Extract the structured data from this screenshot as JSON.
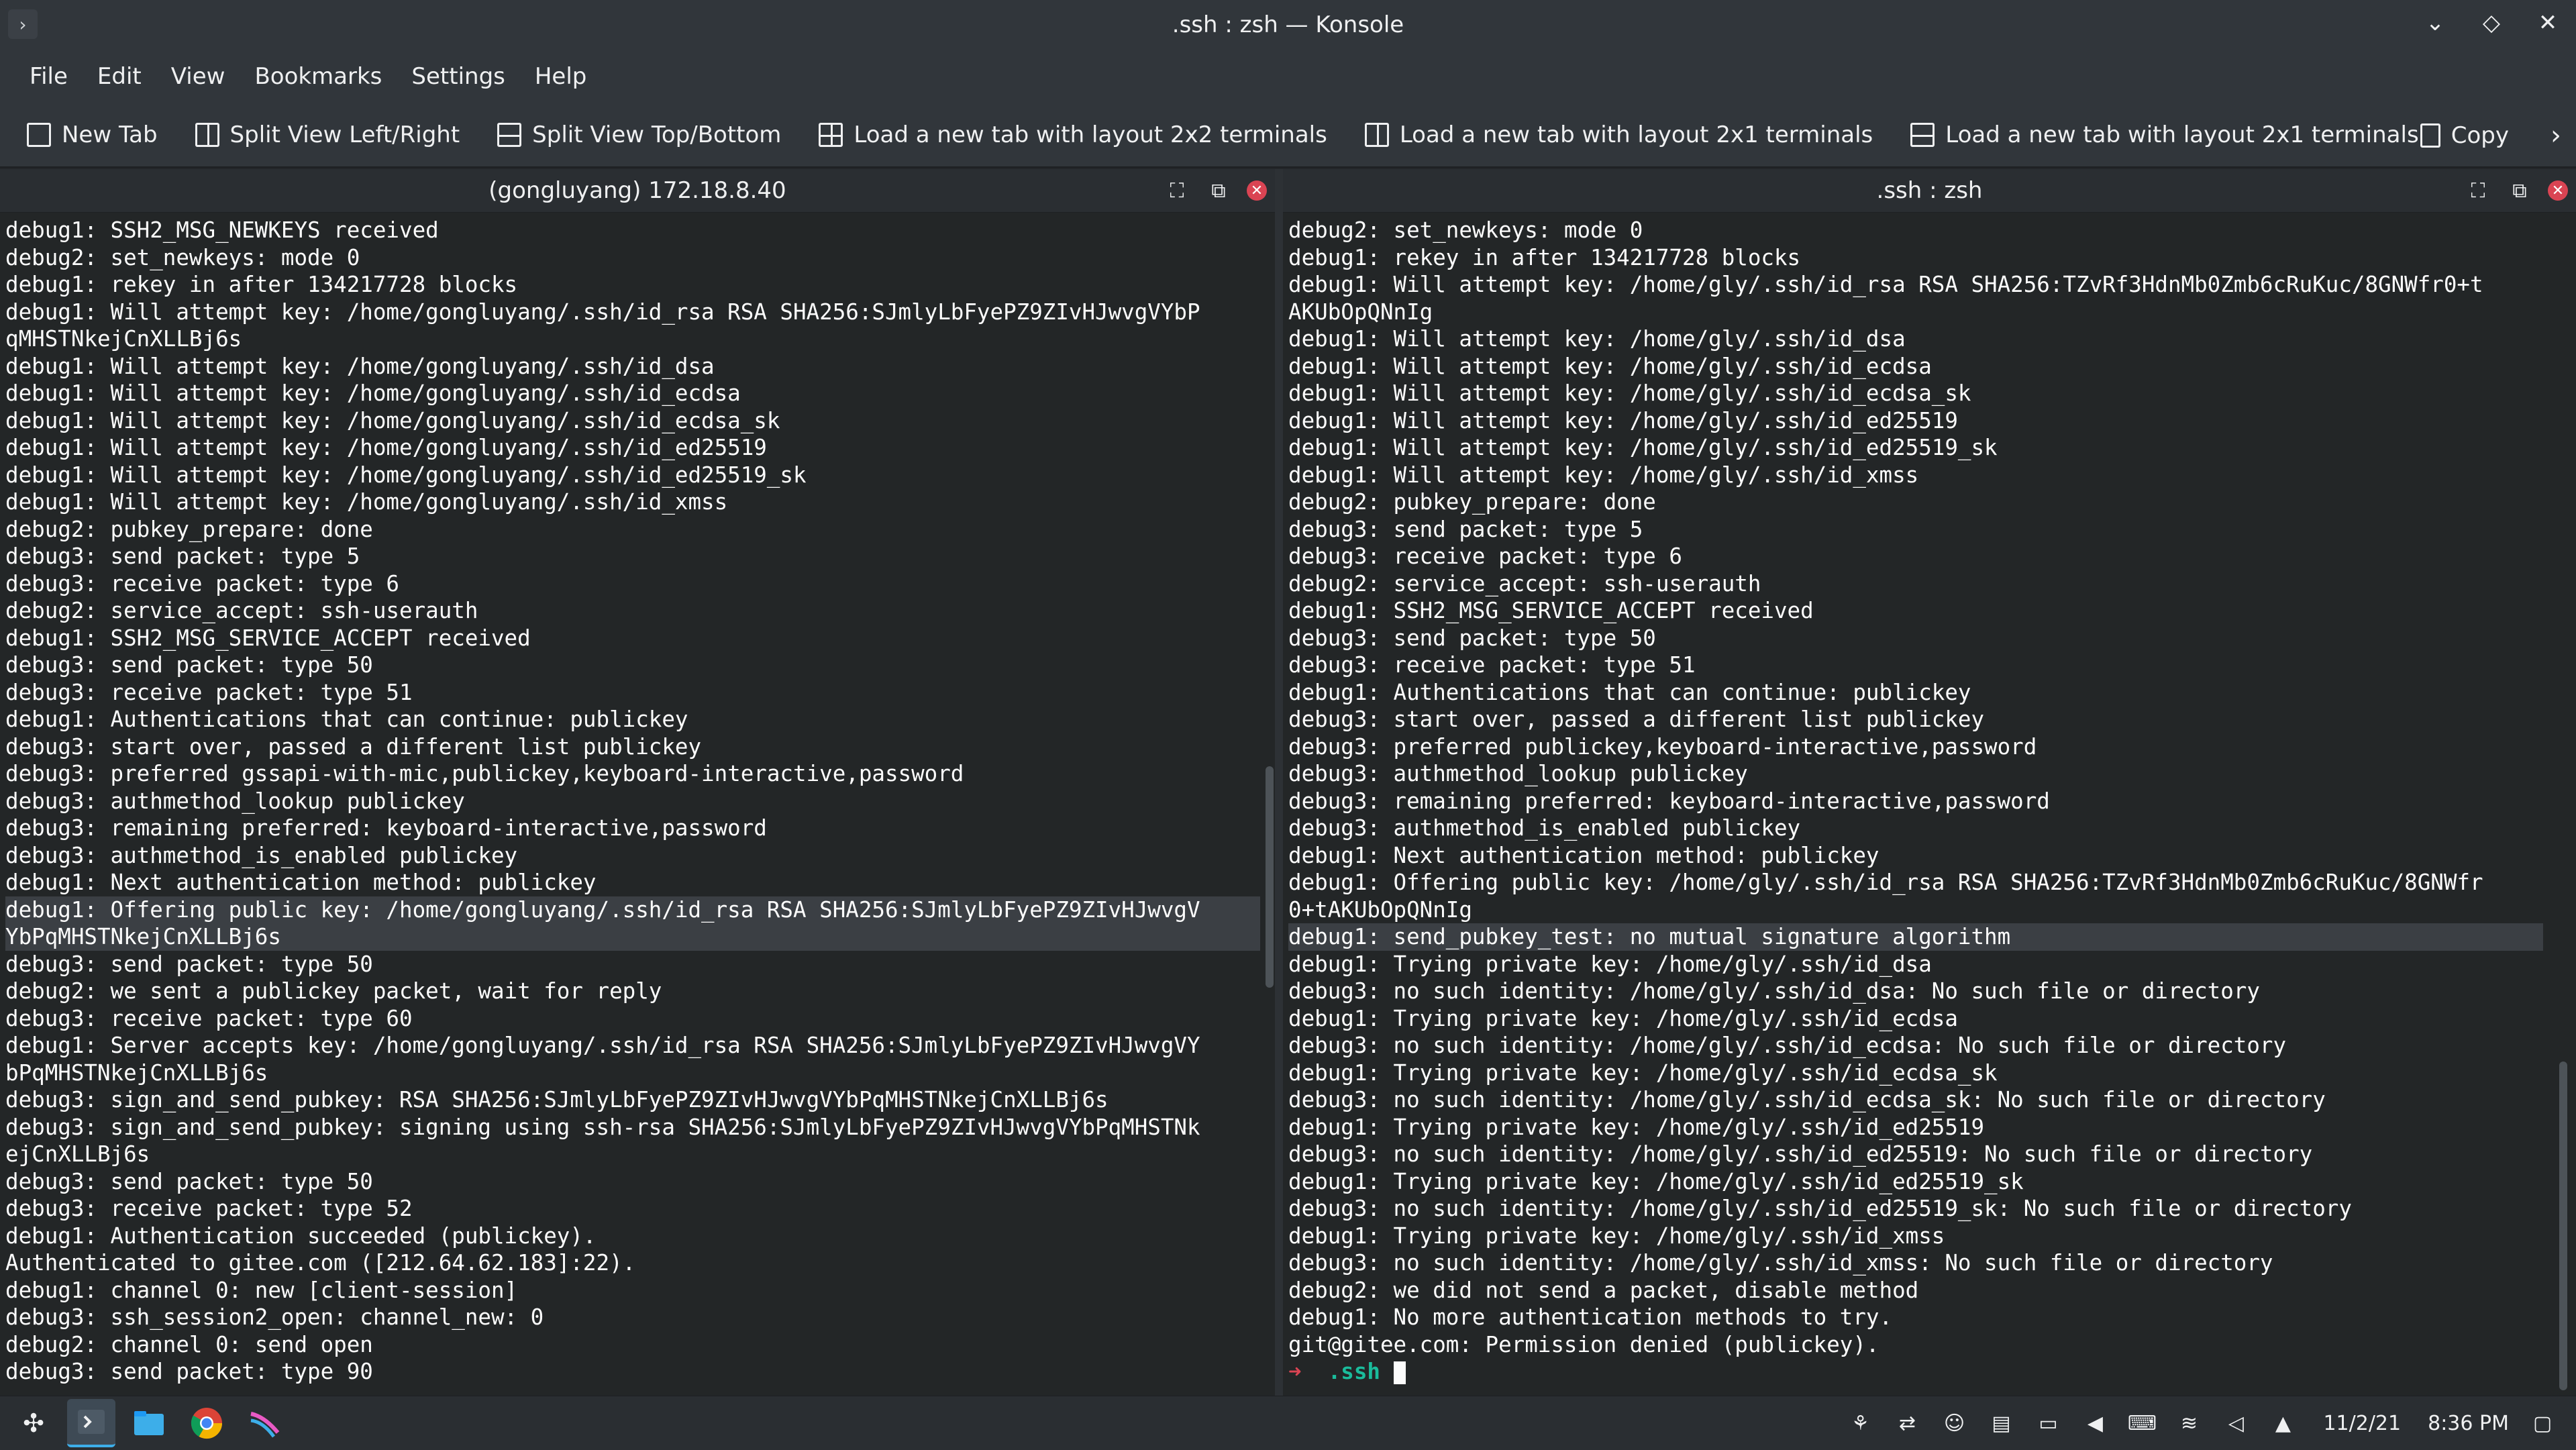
{
  "window": {
    "title": ".ssh : zsh — Konsole"
  },
  "menu": [
    "File",
    "Edit",
    "View",
    "Bookmarks",
    "Settings",
    "Help"
  ],
  "toolbar": {
    "new_tab": "New Tab",
    "split_lr": "Split View Left/Right",
    "split_tb": "Split View Top/Bottom",
    "layout_2x2": "Load a new tab with layout 2x2 terminals",
    "layout_2x1_a": "Load a new tab with layout 2x1 terminals",
    "layout_2x1_b": "Load a new tab with layout 2x1 terminals",
    "copy": "Copy"
  },
  "left_pane": {
    "title": "(gongluyang) 172.18.8.40",
    "lines": [
      "debug1: SSH2_MSG_NEWKEYS received",
      "debug2: set_newkeys: mode 0",
      "debug1: rekey in after 134217728 blocks",
      "debug1: Will attempt key: /home/gongluyang/.ssh/id_rsa RSA SHA256:SJmlyLbFyePZ9ZIvHJwvgVYbP",
      "qMHSTNkejCnXLLBj6s",
      "debug1: Will attempt key: /home/gongluyang/.ssh/id_dsa",
      "debug1: Will attempt key: /home/gongluyang/.ssh/id_ecdsa",
      "debug1: Will attempt key: /home/gongluyang/.ssh/id_ecdsa_sk",
      "debug1: Will attempt key: /home/gongluyang/.ssh/id_ed25519",
      "debug1: Will attempt key: /home/gongluyang/.ssh/id_ed25519_sk",
      "debug1: Will attempt key: /home/gongluyang/.ssh/id_xmss",
      "debug2: pubkey_prepare: done",
      "debug3: send packet: type 5",
      "debug3: receive packet: type 6",
      "debug2: service_accept: ssh-userauth",
      "debug1: SSH2_MSG_SERVICE_ACCEPT received",
      "debug3: send packet: type 50",
      "debug3: receive packet: type 51",
      "debug1: Authentications that can continue: publickey",
      "debug3: start over, passed a different list publickey",
      "debug3: preferred gssapi-with-mic,publickey,keyboard-interactive,password",
      "debug3: authmethod_lookup publickey",
      "debug3: remaining preferred: keyboard-interactive,password",
      "debug3: authmethod_is_enabled publickey",
      "debug1: Next authentication method: publickey",
      "debug1: Offering public key: /home/gongluyang/.ssh/id_rsa RSA SHA256:SJmlyLbFyePZ9ZIvHJwvgV",
      "YbPqMHSTNkejCnXLLBj6s",
      "debug3: send packet: type 50",
      "debug2: we sent a publickey packet, wait for reply",
      "debug3: receive packet: type 60",
      "debug1: Server accepts key: /home/gongluyang/.ssh/id_rsa RSA SHA256:SJmlyLbFyePZ9ZIvHJwvgVY",
      "bPqMHSTNkejCnXLLBj6s",
      "debug3: sign_and_send_pubkey: RSA SHA256:SJmlyLbFyePZ9ZIvHJwvgVYbPqMHSTNkejCnXLLBj6s",
      "debug3: sign_and_send_pubkey: signing using ssh-rsa SHA256:SJmlyLbFyePZ9ZIvHJwvgVYbPqMHSTNk",
      "ejCnXLLBj6s",
      "debug3: send packet: type 50",
      "debug3: receive packet: type 52",
      "debug1: Authentication succeeded (publickey).",
      "Authenticated to gitee.com ([212.64.62.183]:22).",
      "debug1: channel 0: new [client-session]",
      "debug3: ssh_session2_open: channel_new: 0",
      "debug2: channel 0: send open",
      "debug3: send packet: type 90"
    ]
  },
  "right_pane": {
    "title": ".ssh : zsh",
    "lines": [
      "debug2: set_newkeys: mode 0",
      "debug1: rekey in after 134217728 blocks",
      "debug1: Will attempt key: /home/gly/.ssh/id_rsa RSA SHA256:TZvRf3HdnMb0Zmb6cRuKuc/8GNWfr0+t",
      "AKUbOpQNnIg",
      "debug1: Will attempt key: /home/gly/.ssh/id_dsa",
      "debug1: Will attempt key: /home/gly/.ssh/id_ecdsa",
      "debug1: Will attempt key: /home/gly/.ssh/id_ecdsa_sk",
      "debug1: Will attempt key: /home/gly/.ssh/id_ed25519",
      "debug1: Will attempt key: /home/gly/.ssh/id_ed25519_sk",
      "debug1: Will attempt key: /home/gly/.ssh/id_xmss",
      "debug2: pubkey_prepare: done",
      "debug3: send packet: type 5",
      "debug3: receive packet: type 6",
      "debug2: service_accept: ssh-userauth",
      "debug1: SSH2_MSG_SERVICE_ACCEPT received",
      "debug3: send packet: type 50",
      "debug3: receive packet: type 51",
      "debug1: Authentications that can continue: publickey",
      "debug3: start over, passed a different list publickey",
      "debug3: preferred publickey,keyboard-interactive,password",
      "debug3: authmethod_lookup publickey",
      "debug3: remaining preferred: keyboard-interactive,password",
      "debug3: authmethod_is_enabled publickey",
      "debug1: Next authentication method: publickey",
      "debug1: Offering public key: /home/gly/.ssh/id_rsa RSA SHA256:TZvRf3HdnMb0Zmb6cRuKuc/8GNWfr",
      "0+tAKUbOpQNnIg",
      "debug1: send_pubkey_test: no mutual signature algorithm",
      "debug1: Trying private key: /home/gly/.ssh/id_dsa",
      "debug3: no such identity: /home/gly/.ssh/id_dsa: No such file or directory",
      "debug1: Trying private key: /home/gly/.ssh/id_ecdsa",
      "debug3: no such identity: /home/gly/.ssh/id_ecdsa: No such file or directory",
      "debug1: Trying private key: /home/gly/.ssh/id_ecdsa_sk",
      "debug3: no such identity: /home/gly/.ssh/id_ecdsa_sk: No such file or directory",
      "debug1: Trying private key: /home/gly/.ssh/id_ed25519",
      "debug3: no such identity: /home/gly/.ssh/id_ed25519: No such file or directory",
      "debug1: Trying private key: /home/gly/.ssh/id_ed25519_sk",
      "debug3: no such identity: /home/gly/.ssh/id_ed25519_sk: No such file or directory",
      "debug1: Trying private key: /home/gly/.ssh/id_xmss",
      "debug3: no such identity: /home/gly/.ssh/id_xmss: No such file or directory",
      "debug2: we did not send a packet, disable method",
      "debug1: No more authentication methods to try.",
      "git@gitee.com: Permission denied (publickey)."
    ],
    "prompt_arrow": "➜",
    "prompt_dir": ".ssh"
  },
  "taskbar": {
    "date": "11/2/21",
    "time": "8:36 PM"
  },
  "colors": {
    "accent": "#3daee9",
    "close_red": "#da4453",
    "prompt_teal": "#1abc9c"
  }
}
